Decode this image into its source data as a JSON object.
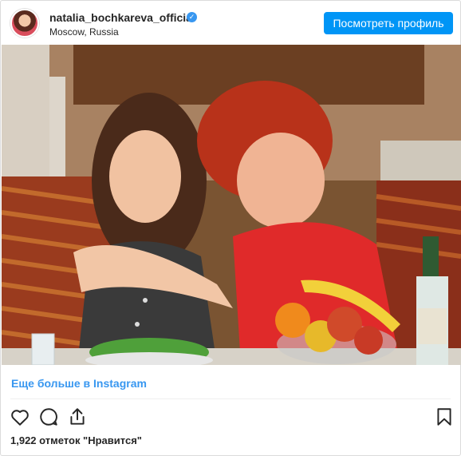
{
  "post": {
    "username": "natalia_bochkareva_official",
    "location": "Moscow, Russia",
    "profile_button": "Посмотреть профиль",
    "more_link": "Еще больше в Instagram",
    "likes_text": "1,922 отметок \"Нравится\""
  },
  "icons": {
    "verified": "verified-badge-icon",
    "like": "heart-icon",
    "comment": "comment-bubble-icon",
    "share": "share-icon",
    "save": "bookmark-icon"
  },
  "colors": {
    "accent": "#0095f6",
    "link": "#3897f0",
    "text": "#262626"
  }
}
